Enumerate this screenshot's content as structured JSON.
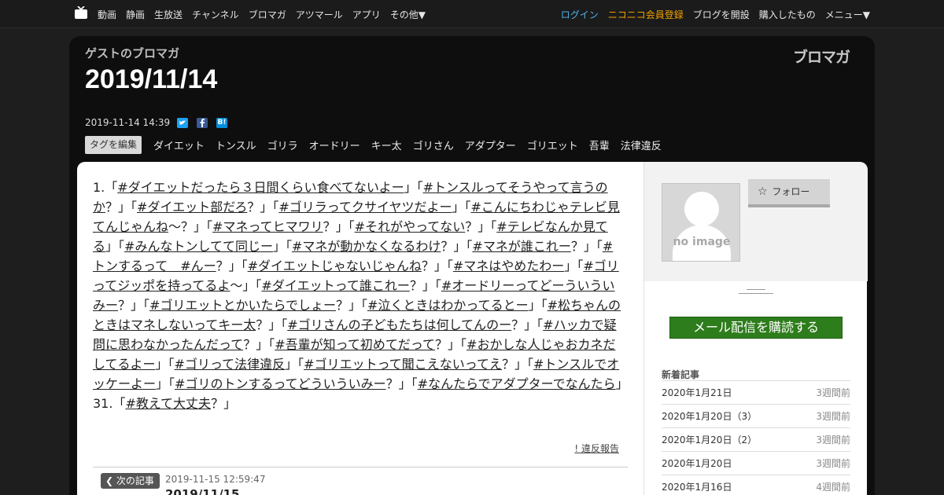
{
  "nav": {
    "left": [
      "動画",
      "静画",
      "生放送",
      "チャンネル",
      "ブロマガ",
      "アツマール",
      "アプリ",
      "その他▼"
    ],
    "login": "ログイン",
    "register": "ニコニコ会員登録",
    "open_blog": "ブログを開設",
    "purchased": "購入したもの",
    "menu": "メニュー▼"
  },
  "blog_name": "ゲストのブロマガ",
  "brand": "ブロマガ",
  "page_title": "2019/11/14",
  "meta_date": "2019-11-14 14:39",
  "share_labels": {
    "hatena": "B!"
  },
  "tag_edit": "タグを編集",
  "tags": [
    "ダイエット",
    "トンスル",
    "ゴリラ",
    "オードリー",
    "キー太",
    "ゴリさん",
    "アダプター",
    "ゴリエット",
    "吾輩",
    "法律違反"
  ],
  "article": {
    "segments": [
      {
        "t": "1.「"
      },
      {
        "t": "#ダイエットだったら３日間くらい食べてないよー",
        "l": 1
      },
      {
        "t": "」「"
      },
      {
        "t": "#トンスルってそうやって言うのか",
        "l": 1
      },
      {
        "t": "？」「"
      },
      {
        "t": "#ダイエット部だろ",
        "l": 1
      },
      {
        "t": "？」「"
      },
      {
        "t": "#ゴリラってクサイヤツだよー",
        "l": 1
      },
      {
        "t": "」「"
      },
      {
        "t": "#こんにちわじゃテレビ見てんじゃんね",
        "l": 1
      },
      {
        "t": "〜？」「"
      },
      {
        "t": "#マネってヒマワリ",
        "l": 1
      },
      {
        "t": "？」「"
      },
      {
        "t": "#それがやってない",
        "l": 1
      },
      {
        "t": "？」「"
      },
      {
        "t": "#テレビなんか見てる",
        "l": 1
      },
      {
        "t": "」「"
      },
      {
        "t": "#みんなトンしてて同じー",
        "l": 1
      },
      {
        "t": "」「"
      },
      {
        "t": "#マネが動かなくなるわけ",
        "l": 1
      },
      {
        "t": "？」「"
      },
      {
        "t": "#マネが誰これー",
        "l": 1
      },
      {
        "t": "？」「"
      },
      {
        "t": "#トンするって　#んー",
        "l": 1
      },
      {
        "t": "？」「"
      },
      {
        "t": "#ダイエットじゃないじゃんね",
        "l": 1
      },
      {
        "t": "？」「"
      },
      {
        "t": "#マネはやめたわー",
        "l": 1
      },
      {
        "t": "」「"
      },
      {
        "t": "#ゴリってジッポを持ってるよ",
        "l": 1
      },
      {
        "t": "〜」「"
      },
      {
        "t": "#ダイエットって誰これー",
        "l": 1
      },
      {
        "t": "？」「"
      },
      {
        "t": "#オードリーってどーういういみー",
        "l": 1
      },
      {
        "t": "？」「"
      },
      {
        "t": "#ゴリエットとかいたらでしょー",
        "l": 1
      },
      {
        "t": "？」「"
      },
      {
        "t": "#泣くときはわかってるとー",
        "l": 1
      },
      {
        "t": "」「"
      },
      {
        "t": "#松ちゃんのときはマネしないってキー太",
        "l": 1
      },
      {
        "t": "？」「"
      },
      {
        "t": "#ゴリさんの子どもたちは何してんのー",
        "l": 1
      },
      {
        "t": "？」「"
      },
      {
        "t": "#ハッカで疑問に思わなかったんだって",
        "l": 1
      },
      {
        "t": "？」「"
      },
      {
        "t": "#吾輩が知って初めてだって",
        "l": 1
      },
      {
        "t": "？」「"
      },
      {
        "t": "#おかしな人じゃおカネだしてるよー",
        "l": 1
      },
      {
        "t": "」「"
      },
      {
        "t": "#ゴリって法律違反",
        "l": 1
      },
      {
        "t": "」「"
      },
      {
        "t": "#ゴリエットって聞こえないってえ",
        "l": 1
      },
      {
        "t": "？」「"
      },
      {
        "t": "#トンスルでオッケーよー",
        "l": 1
      },
      {
        "t": "」「"
      },
      {
        "t": "#ゴリのトンするってどういういみー",
        "l": 1
      },
      {
        "t": "？」「"
      },
      {
        "t": "#なんたらでアダプターでなんたら",
        "l": 1
      },
      {
        "t": "」31.「"
      },
      {
        "t": "#教えて大丈夫",
        "l": 1
      },
      {
        "t": "？」"
      }
    ],
    "report": "! 違反報告",
    "next_button": "次の記事",
    "next_date": "2019-11-15 12:59:47",
    "next_title": "2019/11/15"
  },
  "sidebar": {
    "avatar_text": "no image",
    "follow": "フォロー",
    "subscribe": "メール配信を購読する",
    "recent_heading": "新着記事",
    "recent": [
      {
        "title": "2020年1月21日",
        "ago": "3週間前"
      },
      {
        "title": "2020年1月20日（3）",
        "ago": "3週間前"
      },
      {
        "title": "2020年1月20日（2）",
        "ago": "3週間前"
      },
      {
        "title": "2020年1月20日",
        "ago": "3週間前"
      },
      {
        "title": "2020年1月16日",
        "ago": "4週間前"
      }
    ]
  },
  "colors": {
    "login": "#4fb3e8",
    "register": "#f0a000",
    "subscribe": "#2e7d1c",
    "page_bg": "#1e1e1e"
  }
}
